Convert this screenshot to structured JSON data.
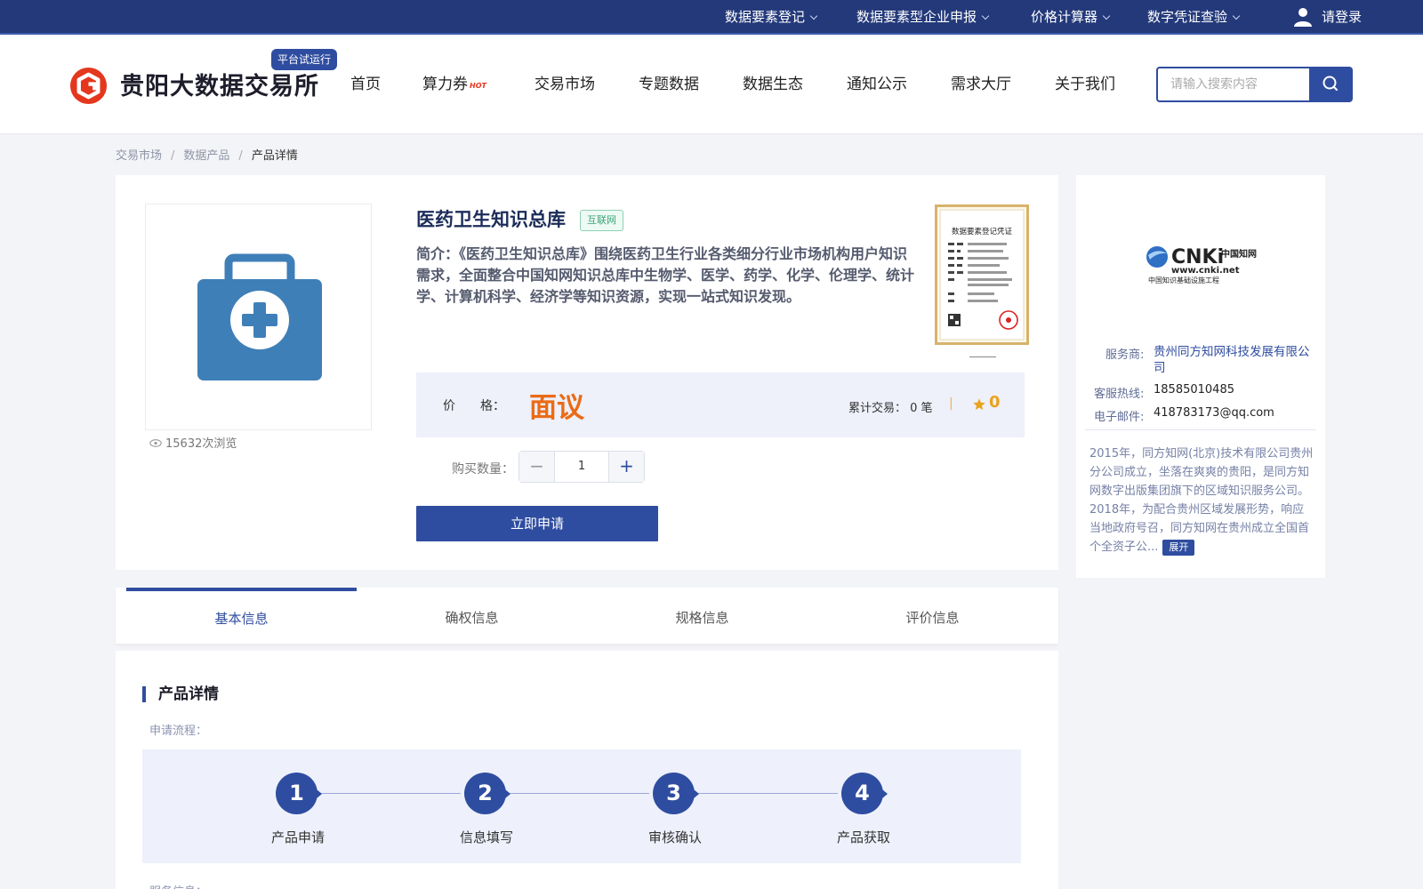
{
  "topbar": {
    "links": [
      {
        "label": "数据要素登记"
      },
      {
        "label": "数据要素型企业申报"
      },
      {
        "label": "价格计算器"
      },
      {
        "label": "数字凭证查验"
      }
    ],
    "login": "请登录"
  },
  "header": {
    "logo_text": "贵阳大数据交易所",
    "trial_badge": "平台试运行",
    "nav": [
      "首页",
      "算力券",
      "交易市场",
      "专题数据",
      "数据生态",
      "通知公示",
      "需求大厅",
      "关于我们"
    ],
    "hot_tag": "HOT",
    "search_placeholder": "请输入搜索内容"
  },
  "breadcrumb": [
    "交易市场",
    "数据产品",
    "产品详情"
  ],
  "product": {
    "title": "医药卫生知识总库",
    "tag": "互联网",
    "description": "简介：《医药卫生知识总库》围绕医药卫生行业各类细分行业市场机构用户知识需求，全面整合中国知网知识总库中生物学、医学、药学、化学、伦理学、统计学、计算机科学、经济学等知识资源，实现一站式知识发现。",
    "views": "15632次浏览",
    "cert_title": "数据要素登记凭证",
    "price_label": "价　　格：",
    "price": "面议",
    "trade_label": "累计交易：",
    "trade_value": "0 笔",
    "rating": "0",
    "qty_label": "购买数量：",
    "qty_value": "1",
    "apply_label": "立即申请",
    "colors": {
      "accent": "#2f4da0",
      "price": "#ea6b16",
      "star": "#e9a31c"
    }
  },
  "provider": {
    "logo_text": "www.cnki.net",
    "logo_cn": "中国知网",
    "logo_sub": "中国知识基础设施工程",
    "service_label": "服务商:",
    "service_value": "贵州同方知网科技发展有限公司",
    "hotline_label": "客服热线:",
    "hotline_value": "18585010485",
    "email_label": "电子邮件:",
    "email_value": "418783173@qq.com",
    "intro": "2015年，同方知网(北京)技术有限公司贵州分公司成立，坐落在爽爽的贵阳，是同方知网数字出版集团旗下的区域知识服务公司。 2018年，为配合贵州区域发展形势，响应当地政府号召，同方知网在贵州成立全国首个全资子公...",
    "expand": "展开"
  },
  "tabs": [
    "基本信息",
    "确权信息",
    "规格信息",
    "评价信息"
  ],
  "detail": {
    "title": "产品详情",
    "flow_label": "申请流程：",
    "steps": [
      {
        "num": "1",
        "label": "产品申请"
      },
      {
        "num": "2",
        "label": "信息填写"
      },
      {
        "num": "3",
        "label": "审核确认"
      },
      {
        "num": "4",
        "label": "产品获取"
      }
    ],
    "service_label": "服务信息："
  }
}
